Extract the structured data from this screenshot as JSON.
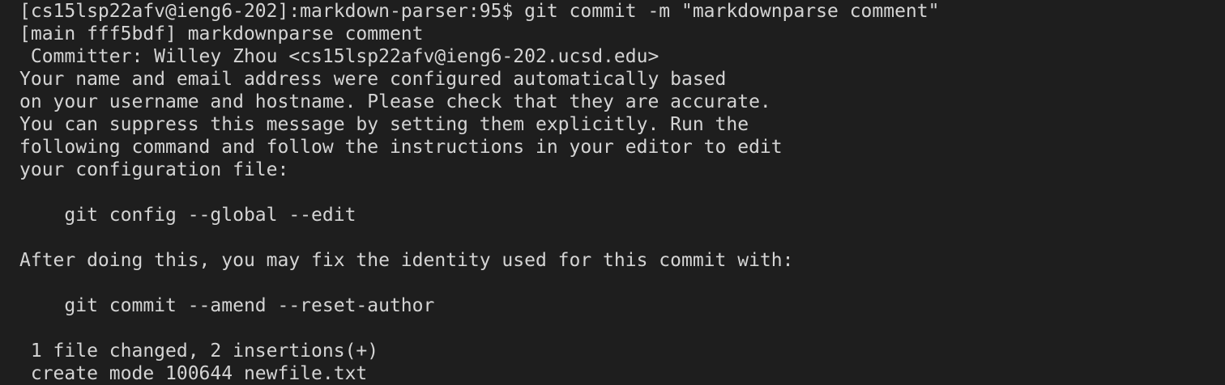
{
  "terminal": {
    "lines": [
      "[cs15lsp22afv@ieng6-202]:markdown-parser:95$ git commit -m \"markdownparse comment\"",
      "[main fff5bdf] markdownparse comment",
      " Committer: Willey Zhou <cs15lsp22afv@ieng6-202.ucsd.edu>",
      "Your name and email address were configured automatically based",
      "on your username and hostname. Please check that they are accurate.",
      "You can suppress this message by setting them explicitly. Run the",
      "following command and follow the instructions in your editor to edit",
      "your configuration file:",
      "",
      "    git config --global --edit",
      "",
      "After doing this, you may fix the identity used for this commit with:",
      "",
      "    git commit --amend --reset-author",
      "",
      " 1 file changed, 2 insertions(+)",
      " create mode 100644 newfile.txt"
    ]
  }
}
